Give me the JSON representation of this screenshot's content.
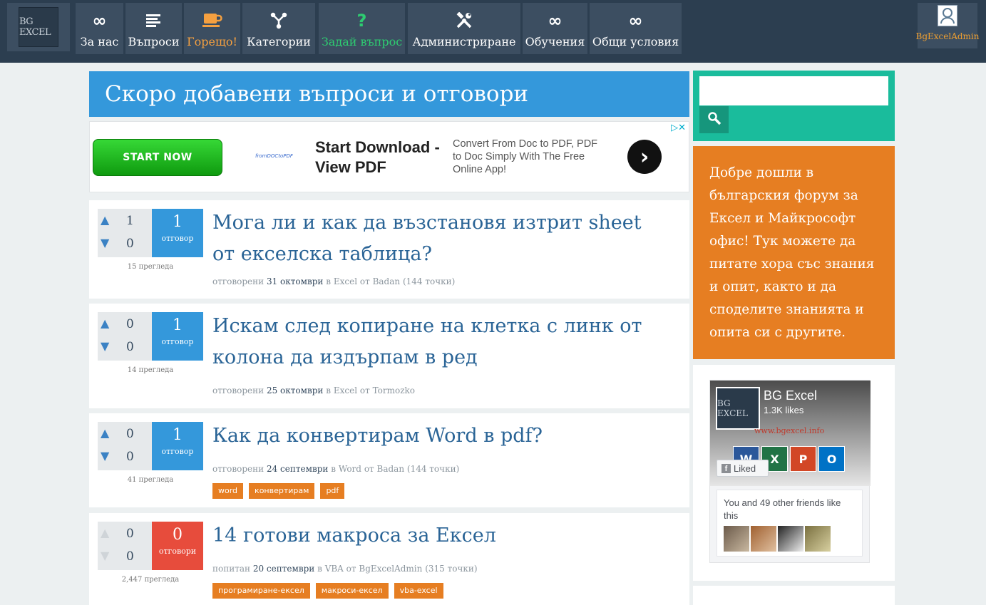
{
  "header": {
    "logo_text": "BG EXCEL",
    "nav": [
      {
        "label": "За нас",
        "icon": "infinity-icon"
      },
      {
        "label": "Въпроси",
        "icon": "list-icon"
      },
      {
        "label": "Горещо!",
        "icon": "coffee-cup-icon"
      },
      {
        "label": "Категории",
        "icon": "share-network-icon"
      },
      {
        "label": "Задай въпрос",
        "icon": "question-mark-icon"
      },
      {
        "label": "Администриране",
        "icon": "tools-icon"
      },
      {
        "label": "Обучения",
        "icon": "infinity-icon"
      },
      {
        "label": "Общи условия",
        "icon": "infinity-icon"
      }
    ],
    "user": {
      "name": "BgExcelAdmin",
      "icon": "user-avatar-icon"
    }
  },
  "main": {
    "title": "Скоро добавени въпроси и отговори",
    "ad": {
      "button_label": "START NOW",
      "brand": "fromDOCtoPDF",
      "headline": "Start Download - View PDF",
      "description": "Convert From Doc to PDF, PDF to Doc Simply With The Free Online App!",
      "arrow": "›",
      "adchoices": "▷✕"
    },
    "questions": [
      {
        "up": "1",
        "down": "0",
        "answers": "1",
        "answers_word": "отговор",
        "views": "15 прегледа",
        "title": "Мога ли и как да възстановя изтрит sheet от екселска таблица?",
        "meta_action": "отговорени",
        "meta_date": "31 октомври",
        "meta_in": "в",
        "meta_category": "Excel",
        "meta_by": "от",
        "meta_user": "Badan",
        "meta_points": "(144 точки)",
        "tags": []
      },
      {
        "up": "0",
        "down": "0",
        "answers": "1",
        "answers_word": "отговор",
        "views": "14 прегледа",
        "title": "Искам след копиране на клетка с линк от колона да издърпам в ред",
        "meta_action": "отговорени",
        "meta_date": "25 октомври",
        "meta_in": "в",
        "meta_category": "Excel",
        "meta_by": "от",
        "meta_user": "Tormozko",
        "meta_points": "",
        "tags": []
      },
      {
        "up": "0",
        "down": "0",
        "answers": "1",
        "answers_word": "отговор",
        "views": "41 прегледа",
        "title": "Как да конвертирам Word в pdf?",
        "meta_action": "отговорени",
        "meta_date": "24 септември",
        "meta_in": "в",
        "meta_category": "Word",
        "meta_by": "от",
        "meta_user": "Badan",
        "meta_points": "(144 точки)",
        "tags": [
          "word",
          "конвертирам",
          "pdf"
        ]
      },
      {
        "up": "0",
        "down": "0",
        "answers": "0",
        "answers_word": "отговори",
        "views": "2,447 прегледа",
        "title": "14 готови макроса за Ексел",
        "meta_action": "попитан",
        "meta_date": "20 септември",
        "meta_in": "в",
        "meta_category": "VBA",
        "meta_by": "от",
        "meta_user": "BgExcelAdmin",
        "meta_points": "(315 точки)",
        "tags": [
          "програмиране-ексел",
          "макроси-ексел",
          "vba-excel"
        ]
      }
    ]
  },
  "sidebar": {
    "search_placeholder": "",
    "search_icon": "search-icon",
    "welcome": "Добре дошли в българския форум за Ексел и Майкрософт офис! Тук можете да питате хора със знания и опит, както и да споделите знанията и опита си с другите.",
    "facebook": {
      "page_name": "BG Excel",
      "likes": "1.3K likes",
      "logo_text": "BG EXCEL",
      "url": "www.bgexcel.info",
      "app_icons": [
        "W",
        "X",
        "P",
        "O"
      ],
      "liked_label": "Liked",
      "friends_text": "You and 49 other friends like this"
    }
  },
  "colors": {
    "nav_bg": "#2c3e50",
    "nav_item_bg": "#3c4e61",
    "hot": "#f5a040",
    "ask": "#2ecc71",
    "title_bar": "#3498db",
    "answer_box": "#3498db",
    "answer_box_zero": "#e74c3c",
    "question_link": "#2a6496",
    "tag": "#e67e22",
    "search_panel": "#1abc9c",
    "welcome_panel": "#e67e22"
  }
}
